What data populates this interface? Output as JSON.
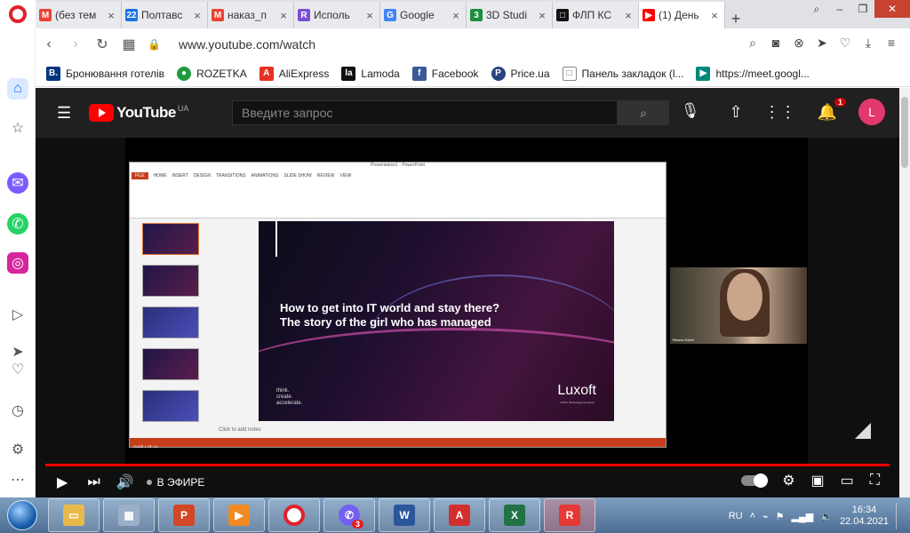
{
  "browser": {
    "tabs": [
      {
        "label": "(без тем",
        "color": "#ea4335",
        "glyph": "M"
      },
      {
        "label": "Полтавс",
        "color": "#1a73e8",
        "glyph": "22"
      },
      {
        "label": "наказ_п",
        "color": "#ea4335",
        "glyph": "M"
      },
      {
        "label": "Исполь",
        "color": "#7b4fd6",
        "glyph": "R"
      },
      {
        "label": "Google",
        "color": "#4285f4",
        "glyph": "G"
      },
      {
        "label": "3D Studi",
        "color": "#1e8e3e",
        "glyph": "3"
      },
      {
        "label": "ФЛП КС",
        "color": "#111111",
        "glyph": "□"
      },
      {
        "label": "(1) День",
        "color": "#ff0000",
        "glyph": "▶"
      }
    ],
    "url": "www.youtube.com/watch",
    "bookmarks": [
      {
        "label": "Бронювання готелів",
        "color": "#003580",
        "glyph": "B."
      },
      {
        "label": "ROZETKA",
        "color": "#1f9b3d",
        "glyph": "●"
      },
      {
        "label": "AliExpress",
        "color": "#e43225",
        "glyph": "A"
      },
      {
        "label": "Lamoda",
        "color": "#111111",
        "glyph": "la"
      },
      {
        "label": "Facebook",
        "color": "#3b5998",
        "glyph": "f"
      },
      {
        "label": "Price.ua",
        "color": "#28437e",
        "glyph": "P"
      },
      {
        "label": "Панель закладок (l...",
        "color": "#888888",
        "glyph": "□"
      },
      {
        "label": "https://meet.googl...",
        "color": "#00897b",
        "glyph": "▶"
      }
    ]
  },
  "youtube": {
    "logo_text": "YouTube",
    "region": "UA",
    "search_placeholder": "Введите запрос",
    "notification_count": "1",
    "avatar_letter": "L",
    "live_label": "В ЭФИРЕ"
  },
  "slide": {
    "window_title": "Presentation1 - PowerPoint",
    "file_tab": "FILE",
    "ribbon_tabs": [
      "HOME",
      "INSERT",
      "DESIGN",
      "TRANSITIONS",
      "ANIMATIONS",
      "SLIDE SHOW",
      "REVIEW",
      "VIEW"
    ],
    "headline_1": "How to get into IT world and stay there?",
    "headline_2": "The story of the girl who has managed",
    "tagline": "think.\ncreate.\naccelerate.",
    "brand": "Luxoft",
    "brand_sub": "A DXC Technology Company",
    "notes": "Click to add notes",
    "status": "SLIDE 1 OF 10"
  },
  "webcam": {
    "label": "Tetiana Golub"
  },
  "taskbar": {
    "lang": "RU",
    "time": "16:34",
    "date": "22.04.2021",
    "viber_badge": "3"
  }
}
